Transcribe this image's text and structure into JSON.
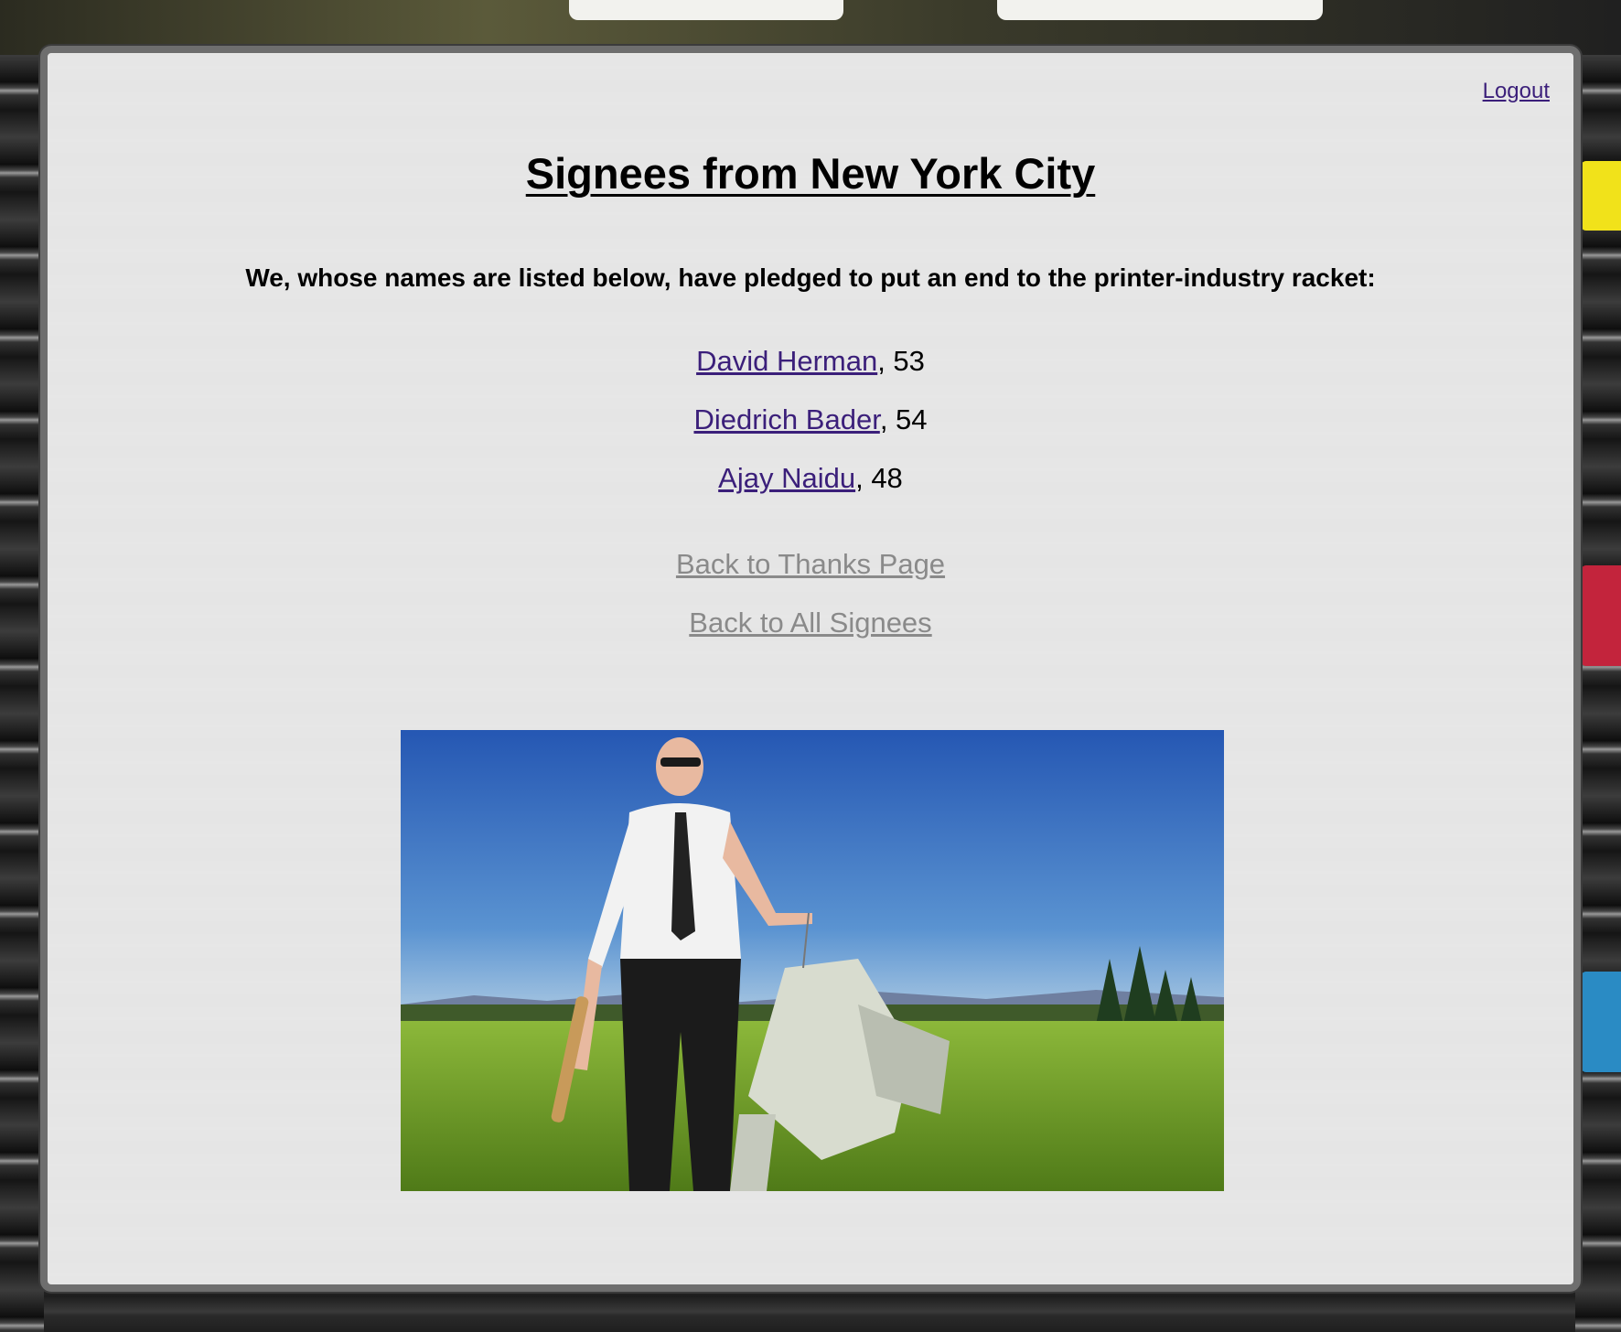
{
  "page": {
    "logout_label": "Logout",
    "title": "Signees from New York City",
    "pledge_text": "We, whose names are listed below, have pledged to put an end to the printer-industry racket:"
  },
  "signees": [
    {
      "name": "David Herman",
      "age_suffix": ", 53"
    },
    {
      "name": "Diedrich Bader",
      "age_suffix": ", 54"
    },
    {
      "name": "Ajay Naidu",
      "age_suffix": ", 48"
    }
  ],
  "nav": {
    "back_thanks": "Back to Thanks Page",
    "back_all": "Back to All Signees"
  },
  "colors": {
    "link": "#3b1f7a",
    "muted_link": "#8a8a8a",
    "panel": "#f0f0f0"
  }
}
